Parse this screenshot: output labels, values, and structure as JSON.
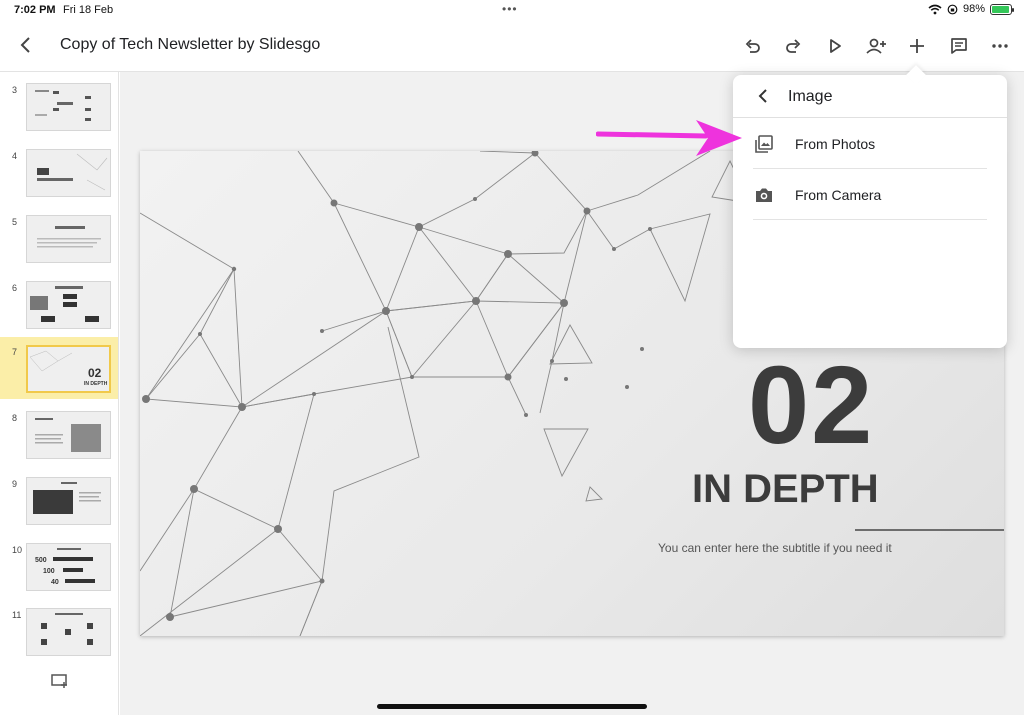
{
  "status_bar": {
    "time": "7:02 PM",
    "date": "Fri 18 Feb",
    "battery": "98%"
  },
  "toolbar": {
    "title": "Copy of Tech Newsletter by Slidesgo",
    "icons": [
      "undo-icon",
      "redo-icon",
      "play-icon",
      "add-person-icon",
      "plus-icon",
      "comment-icon",
      "more-icon"
    ]
  },
  "sidebar": {
    "slides": [
      {
        "number": "3",
        "selected": false
      },
      {
        "number": "4",
        "selected": false
      },
      {
        "number": "5",
        "selected": false
      },
      {
        "number": "6",
        "selected": false
      },
      {
        "number": "7",
        "selected": true
      },
      {
        "number": "8",
        "selected": false
      },
      {
        "number": "9",
        "selected": false
      },
      {
        "number": "10",
        "selected": false
      },
      {
        "number": "11",
        "selected": false
      }
    ]
  },
  "slide": {
    "number": "02",
    "heading": "IN DEPTH",
    "subtitle": "You can enter here the subtitle if you need it"
  },
  "popover": {
    "title": "Image",
    "items": [
      {
        "label": "From Photos",
        "icon": "photos-icon"
      },
      {
        "label": "From Camera",
        "icon": "camera-icon"
      }
    ]
  },
  "colors": {
    "selected_thumb": "#fbeea8",
    "annotation_arrow": "#ee33dd"
  }
}
